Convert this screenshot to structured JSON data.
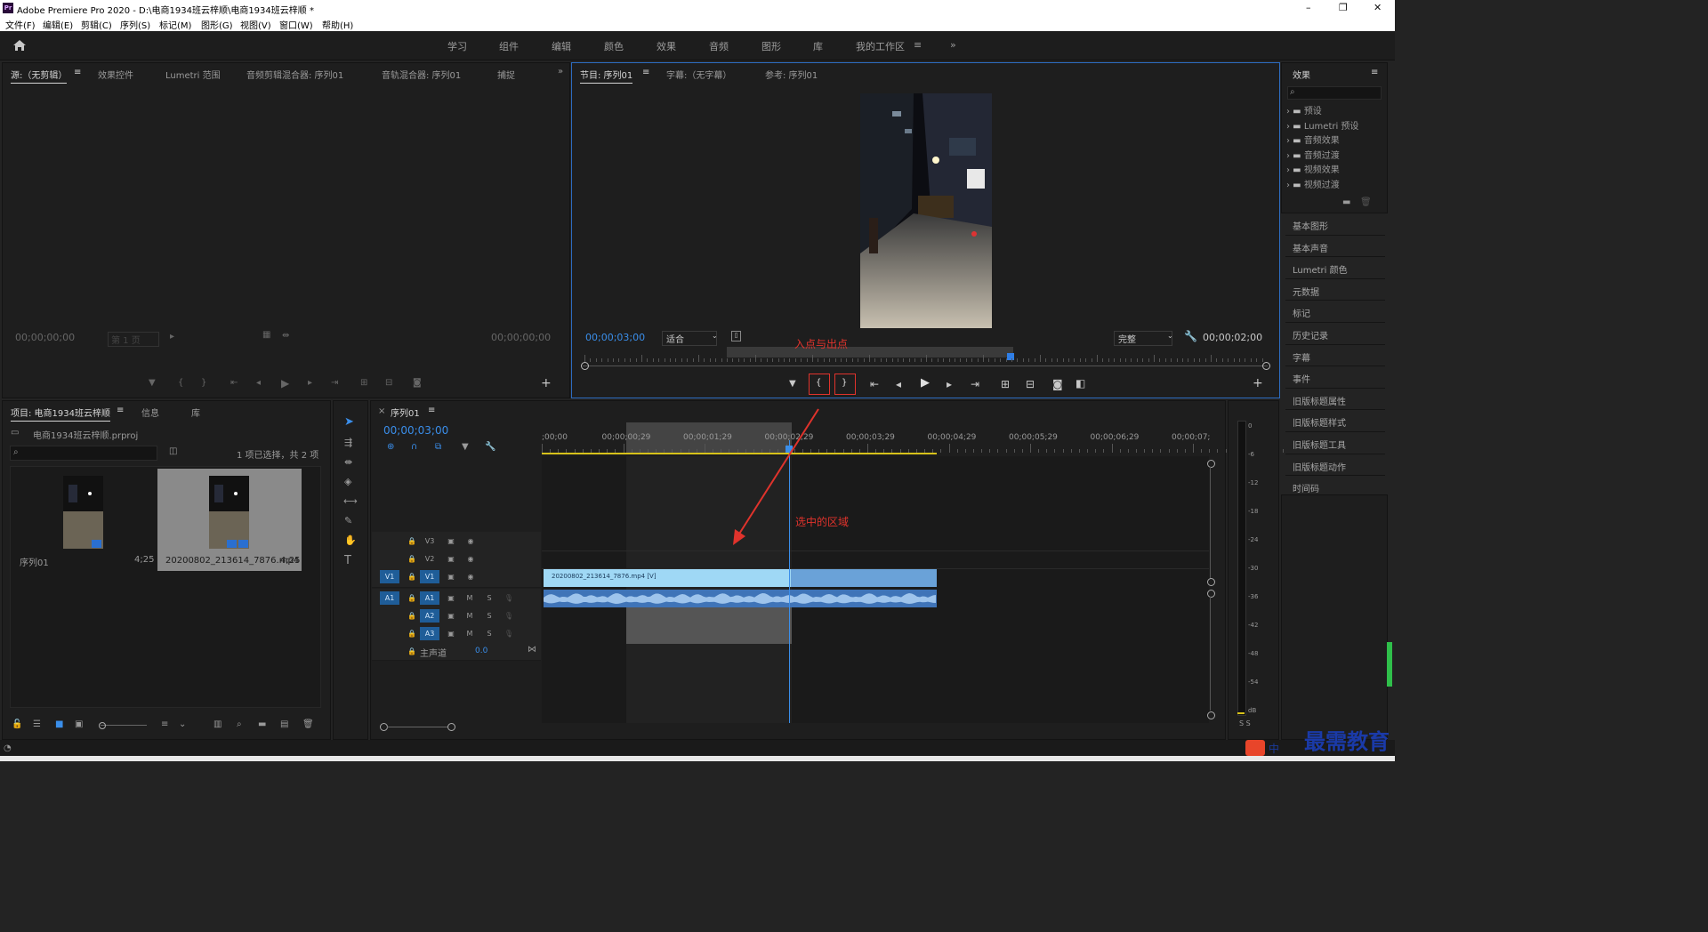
{
  "window": {
    "title": "Adobe Premiere Pro 2020 - D:\\电商1934班云梓顺\\电商1934班云梓顺 *",
    "app_badge": "Pr",
    "minimize": "–",
    "maximize": "❐",
    "close": "✕"
  },
  "menu": [
    "文件(F)",
    "编辑(E)",
    "剪辑(C)",
    "序列(S)",
    "标记(M)",
    "图形(G)",
    "视图(V)",
    "窗口(W)",
    "帮助(H)"
  ],
  "workspaces": [
    "学习",
    "组件",
    "编辑",
    "颜色",
    "效果",
    "音频",
    "图形",
    "库",
    "我的工作区"
  ],
  "active_workspace": "我的工作区",
  "source_panel": {
    "tabs": [
      "源:（无剪辑）",
      "效果控件",
      "Lumetri 范围",
      "音频剪辑混合器: 序列01",
      "音轨混合器: 序列01",
      "捕捉"
    ],
    "timecode_left": "00;00;00;00",
    "timecode_right": "00;00;00;00",
    "page_select": "第 1 页"
  },
  "program_panel": {
    "tabs": [
      "节目: 序列01",
      "字幕:（无字幕）",
      "参考: 序列01"
    ],
    "timecode": "00;00;03;00",
    "fit": "适合",
    "quality": "完整",
    "duration": "00;00;02;00"
  },
  "annotations": {
    "in_out": "入点与出点",
    "selected_region": "选中的区域"
  },
  "project_panel": {
    "tabs": [
      "项目: 电商1934班云梓顺",
      "信息",
      "库"
    ],
    "file": "电商1934班云梓顺.prproj",
    "selection_info": "1 项已选择，共 2 项",
    "items": [
      {
        "name": "序列01",
        "duration": "4;25"
      },
      {
        "name": "20200802_213614_7876.mp4",
        "duration": "4;25"
      }
    ]
  },
  "timeline": {
    "tab": "序列01",
    "timecode": "00;00;03;00",
    "ruler": [
      ";00;00",
      "00;00;00;29",
      "00;00;01;29",
      "00;00;02;29",
      "00;00;03;29",
      "00;00;04;29",
      "00;00;05;29",
      "00;00;06;29",
      "00;00;07;"
    ],
    "video_tracks": [
      "V3",
      "V2",
      "V1"
    ],
    "audio_tracks": [
      "A1",
      "A2",
      "A3"
    ],
    "master": "主声道",
    "master_value": "0.0",
    "clip_name": "20200802_213614_7876.mp4 [V]",
    "source_patch_v": "V1",
    "source_patch_a": "A1",
    "mute": "M",
    "solo": "S"
  },
  "effects_panel": {
    "title": "效果",
    "tree": [
      "预设",
      "Lumetri 预设",
      "音频效果",
      "音频过渡",
      "视频效果",
      "视频过渡"
    ],
    "side": [
      "基本图形",
      "基本声音",
      "Lumetri 颜色",
      "元数据",
      "标记",
      "历史记录",
      "字幕",
      "事件",
      "旧版标题属性",
      "旧版标题样式",
      "旧版标题工具",
      "旧版标题动作",
      "时间码"
    ]
  },
  "meter": {
    "scale": [
      "0",
      "-6",
      "-12",
      "-18",
      "-24",
      "-30",
      "-36",
      "-42",
      "-48",
      "-54",
      "dB"
    ],
    "solo": "S S"
  },
  "taskbar": {
    "ime": "中",
    "watermark": "最需教育"
  }
}
